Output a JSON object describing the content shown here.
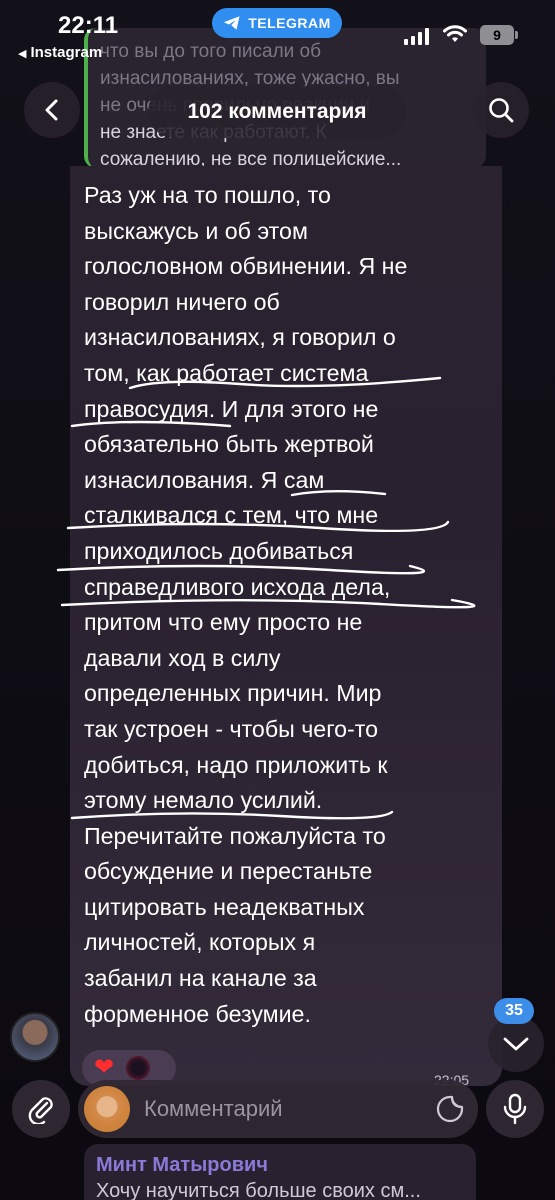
{
  "status_bar": {
    "time": "22:11",
    "back_app": "Instagram",
    "telegram_pill": "TELEGRAM",
    "battery": "9"
  },
  "quoted_message": {
    "author": "Минт Матырович",
    "lines": [
      "что вы до того писали об",
      "изнасилованиях, тоже ужасно, вы",
      "не очень правильно реакции и",
      "не знаете как работают. К",
      "сожалению, не все полицейские..."
    ]
  },
  "header": {
    "title": "102 комментария",
    "back_icon": "chevron-left-icon",
    "search_icon": "search-icon"
  },
  "message": {
    "lines": [
      "Раз уж на то пошло, то",
      "выскажусь и об этом",
      "голословном обвинении. Я не",
      "говорил ничего об",
      "изнасилованиях, я говорил о",
      "том, как работает система",
      "правосудия. И для этого не",
      "обязательно быть жертвой",
      "изнасилования. Я сам",
      "сталкивался с тем, что мне",
      "приходилось добиваться",
      "справедливого исхода дела,",
      "притом что ему просто не",
      "давали ход в силу",
      "определенных причин. Мир",
      "так устроен - чтобы чего-то",
      "добиться, надо приложить к",
      "этому немало усилий.",
      "Перечитайте пожалуйста то",
      "обсуждение и перестаньте",
      "цитировать неадекватных",
      "личностей, которых я",
      "забанил на канале за",
      "форменное безумие."
    ],
    "time": "22:05",
    "reaction_emoji": "❤"
  },
  "scroll_down": {
    "unread_count": "35"
  },
  "input_bar": {
    "placeholder": "Комментарий"
  },
  "next_message": {
    "author": "Минт Матырович",
    "text": "Хочу научиться больше своих см..."
  },
  "colors": {
    "telegram_blue": "#2f8ef0",
    "quote_green": "#5fc25a",
    "bubble_bg": "#2b2230",
    "badge_blue": "#3d8ee8",
    "underline_ink": "#ffffff"
  }
}
